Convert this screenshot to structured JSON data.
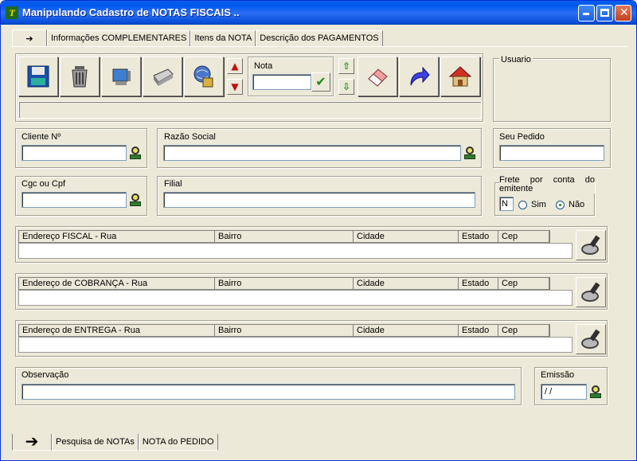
{
  "window": {
    "title": "Manipulando Cadastro de NOTAS FISCAIS ..",
    "app_icon_letter": "T"
  },
  "top_tabs": {
    "arrow": "➔",
    "items": [
      "Informações COMPLEMENTARES",
      "Itens da NOTA",
      "Descrição dos PAGAMENTOS"
    ]
  },
  "toolbar": {
    "nota_label": "Nota",
    "nota_value": "",
    "tools": [
      "save-icon",
      "trash-icon",
      "monitor-icon",
      "printer-icon",
      "globe-search-icon",
      "eraser-icon",
      "redo-arrow-icon",
      "home-icon"
    ]
  },
  "usuario": {
    "label": "Usuario"
  },
  "cliente": {
    "label": "Cliente Nº",
    "value": ""
  },
  "razao_social": {
    "label": "Razão Social",
    "value": ""
  },
  "seu_pedido": {
    "label": "Seu Pedido",
    "value": ""
  },
  "cgc": {
    "label": "Cgc ou Cpf",
    "value": ""
  },
  "filial": {
    "label": "Filial",
    "value": ""
  },
  "frete": {
    "label": "Frete por conta do emitente",
    "code": "N",
    "options": [
      "Sim",
      "Não"
    ],
    "selected": "Não"
  },
  "addresses": [
    {
      "street_label": "Endereço FISCAL - Rua",
      "bairro": "Bairro",
      "cidade": "Cidade",
      "estado": "Estado",
      "cep": "Cep"
    },
    {
      "street_label": "Endereço de COBRANÇA - Rua",
      "bairro": "Bairro",
      "cidade": "Cidade",
      "estado": "Estado",
      "cep": "Cep"
    },
    {
      "street_label": "Endereço de ENTREGA - Rua",
      "bairro": "Bairro",
      "cidade": "Cidade",
      "estado": "Estado",
      "cep": "Cep"
    }
  ],
  "observacao": {
    "label": "Observação",
    "value": ""
  },
  "emissao": {
    "label": "Emissão",
    "value": "/ /"
  },
  "bottom_tabs": {
    "arrow": "➔",
    "items": [
      "Pesquisa de NOTAs",
      "NOTA do PEDIDO"
    ]
  },
  "colors": {
    "titlebar": "#0058ee",
    "window_bg": "#ece9d8"
  }
}
